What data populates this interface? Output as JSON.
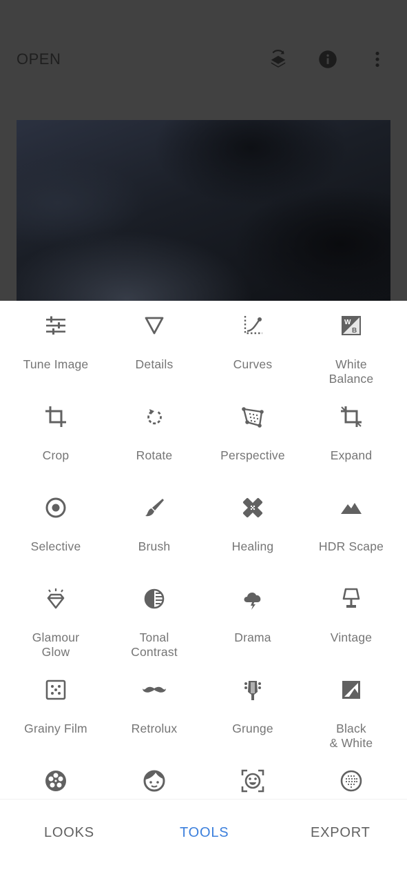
{
  "header": {
    "open_label": "OPEN",
    "icons": [
      "layers-history-icon",
      "info-icon",
      "more-vertical-icon"
    ]
  },
  "tools": [
    {
      "label": "Tune Image",
      "icon": "tune-sliders-icon"
    },
    {
      "label": "Details",
      "icon": "details-triangle-icon"
    },
    {
      "label": "Curves",
      "icon": "curves-icon"
    },
    {
      "label": "White\nBalance",
      "icon": "white-balance-icon"
    },
    {
      "label": "Crop",
      "icon": "crop-icon"
    },
    {
      "label": "Rotate",
      "icon": "rotate-icon"
    },
    {
      "label": "Perspective",
      "icon": "perspective-icon"
    },
    {
      "label": "Expand",
      "icon": "expand-icon"
    },
    {
      "label": "Selective",
      "icon": "selective-target-icon"
    },
    {
      "label": "Brush",
      "icon": "brush-icon"
    },
    {
      "label": "Healing",
      "icon": "healing-bandage-icon"
    },
    {
      "label": "HDR Scape",
      "icon": "mountains-icon"
    },
    {
      "label": "Glamour\nGlow",
      "icon": "diamond-icon"
    },
    {
      "label": "Tonal\nContrast",
      "icon": "tonal-contrast-icon"
    },
    {
      "label": "Drama",
      "icon": "storm-cloud-icon"
    },
    {
      "label": "Vintage",
      "icon": "lamp-icon"
    },
    {
      "label": "Grainy Film",
      "icon": "grain-dots-icon"
    },
    {
      "label": "Retrolux",
      "icon": "mustache-icon"
    },
    {
      "label": "Grunge",
      "icon": "guitar-head-icon"
    },
    {
      "label": "Black\n& White",
      "icon": "black-white-icon"
    },
    {
      "label": "",
      "icon": "film-reel-icon"
    },
    {
      "label": "",
      "icon": "face-icon"
    },
    {
      "label": "",
      "icon": "face-detect-icon"
    },
    {
      "label": "",
      "icon": "dotted-circle-icon"
    }
  ],
  "bottom_nav": {
    "looks": "LOOKS",
    "tools": "TOOLS",
    "export": "EXPORT",
    "active": "tools"
  },
  "colors": {
    "accent": "#3b7fdc",
    "icon_gray": "#616161",
    "label_gray": "#757575"
  }
}
